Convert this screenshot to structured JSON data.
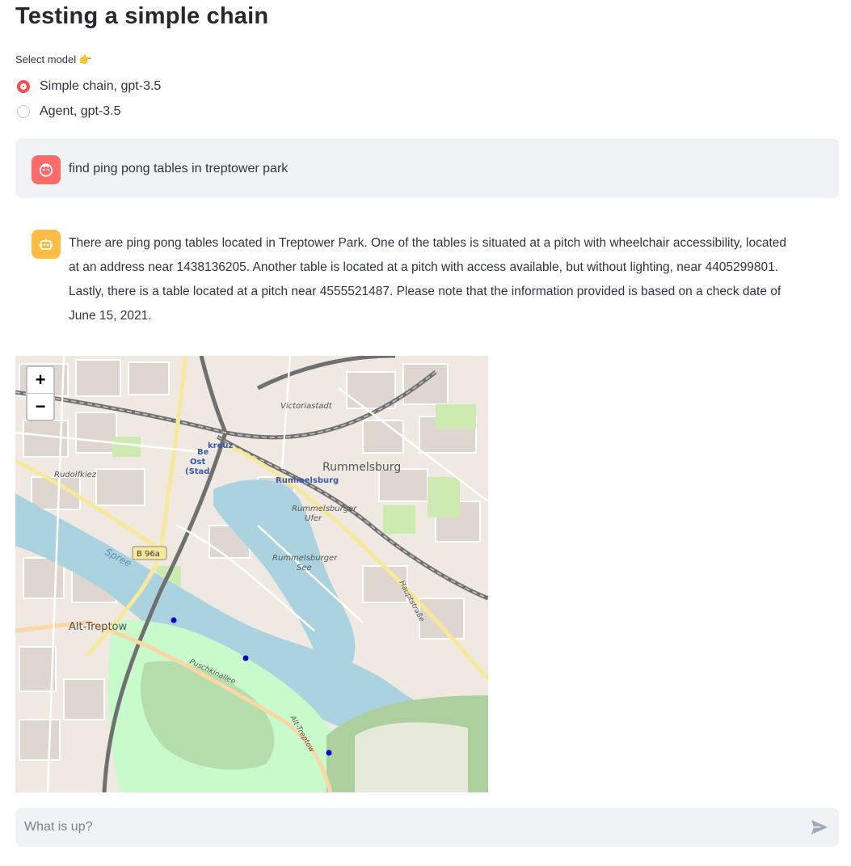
{
  "page": {
    "title": "Testing a simple chain",
    "select_label": "Select model 👉"
  },
  "model_options": [
    {
      "label": "Simple chain, gpt-3.5",
      "selected": true
    },
    {
      "label": "Agent, gpt-3.5",
      "selected": false
    }
  ],
  "messages": [
    {
      "role": "user",
      "avatar_icon": "user-face-icon",
      "text": "find ping pong tables in treptower park"
    },
    {
      "role": "assistant",
      "avatar_icon": "robot-icon",
      "text": "There are ping pong tables located in Treptower Park. One of the tables is situated at a pitch with wheelchair accessibility, located at an address near 1438136205. Another table is located at a pitch with access available, but without lighting, near 4405299801. Lastly, there is a table located at a pitch near 4555521487. Please note that the information provided is based on a check date of June 15, 2021."
    }
  ],
  "map": {
    "zoom_in": "+",
    "zoom_out": "−",
    "labels": {
      "victoriastadt": "Victoriastadt",
      "rummelsburg": "Rummelsburg",
      "rummelsburg_station": "Rummelsburg",
      "rudolfkiez": "Rudolfkiez",
      "rummelsburger_ufer_1": "Rummelsburger",
      "rummelsburger_ufer_2": "Ufer",
      "rummelsburger_see_1": "Rummelsburger",
      "rummelsburger_see_2": "See",
      "spree": "Spree",
      "b96a": "B 96a",
      "alt_treptow": "Alt-Treptow",
      "puschkinallee": "Puschkinallee",
      "alt_treptow_street": "Alt-Treptow",
      "hauptstrasse": "Hauptstraße",
      "kreuz": "kreuz",
      "ost_1": "Be",
      "ost_2": "Ost",
      "ost_3": "(Stad"
    },
    "markers_count": 3
  },
  "chat_input": {
    "placeholder": "What is up?"
  },
  "colors": {
    "accent": "#ff4b4b",
    "user_avatar": "#ff6b6b",
    "bot_avatar": "#ffbd45",
    "water": "#aad3df",
    "park": "#c8facc"
  }
}
